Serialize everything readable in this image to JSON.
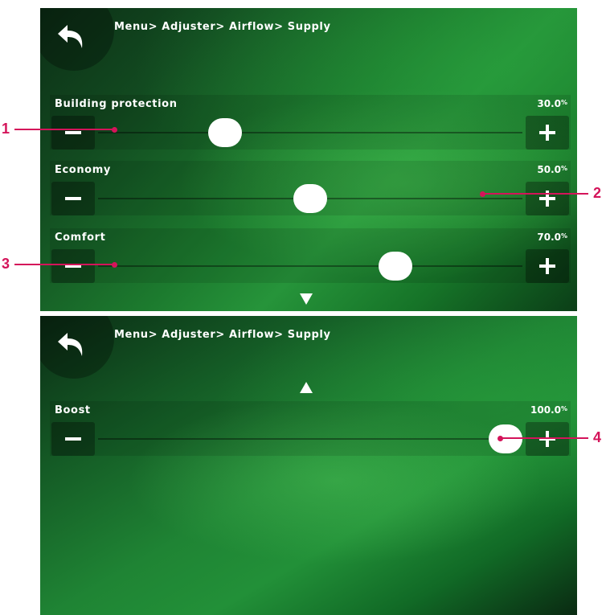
{
  "screens": [
    {
      "breadcrumb": "Menu> Adjuster> Airflow> Supply",
      "settings": [
        {
          "label": "Building protection",
          "value": "30.0",
          "unit": "%",
          "level": 0.3
        },
        {
          "label": "Economy",
          "value": "50.0",
          "unit": "%",
          "level": 0.5
        },
        {
          "label": "Comfort",
          "value": "70.0",
          "unit": "%",
          "level": 0.7
        }
      ],
      "scroll_arrow": "down"
    },
    {
      "breadcrumb": "Menu> Adjuster> Airflow> Supply",
      "settings": [
        {
          "label": "Boost",
          "value": "100.0",
          "unit": "%",
          "level": 1.0
        }
      ],
      "scroll_arrow": "up"
    }
  ],
  "callouts": [
    "1",
    "2",
    "3",
    "4"
  ],
  "colors": {
    "callout": "#d4145a",
    "background_green": "#1c7a2e",
    "knob": "#ffffff"
  },
  "icons": {
    "back": "back-arrow-icon",
    "minus": "minus-icon",
    "plus": "plus-icon",
    "scroll_down": "triangle-down-icon",
    "scroll_up": "triangle-up-icon"
  }
}
